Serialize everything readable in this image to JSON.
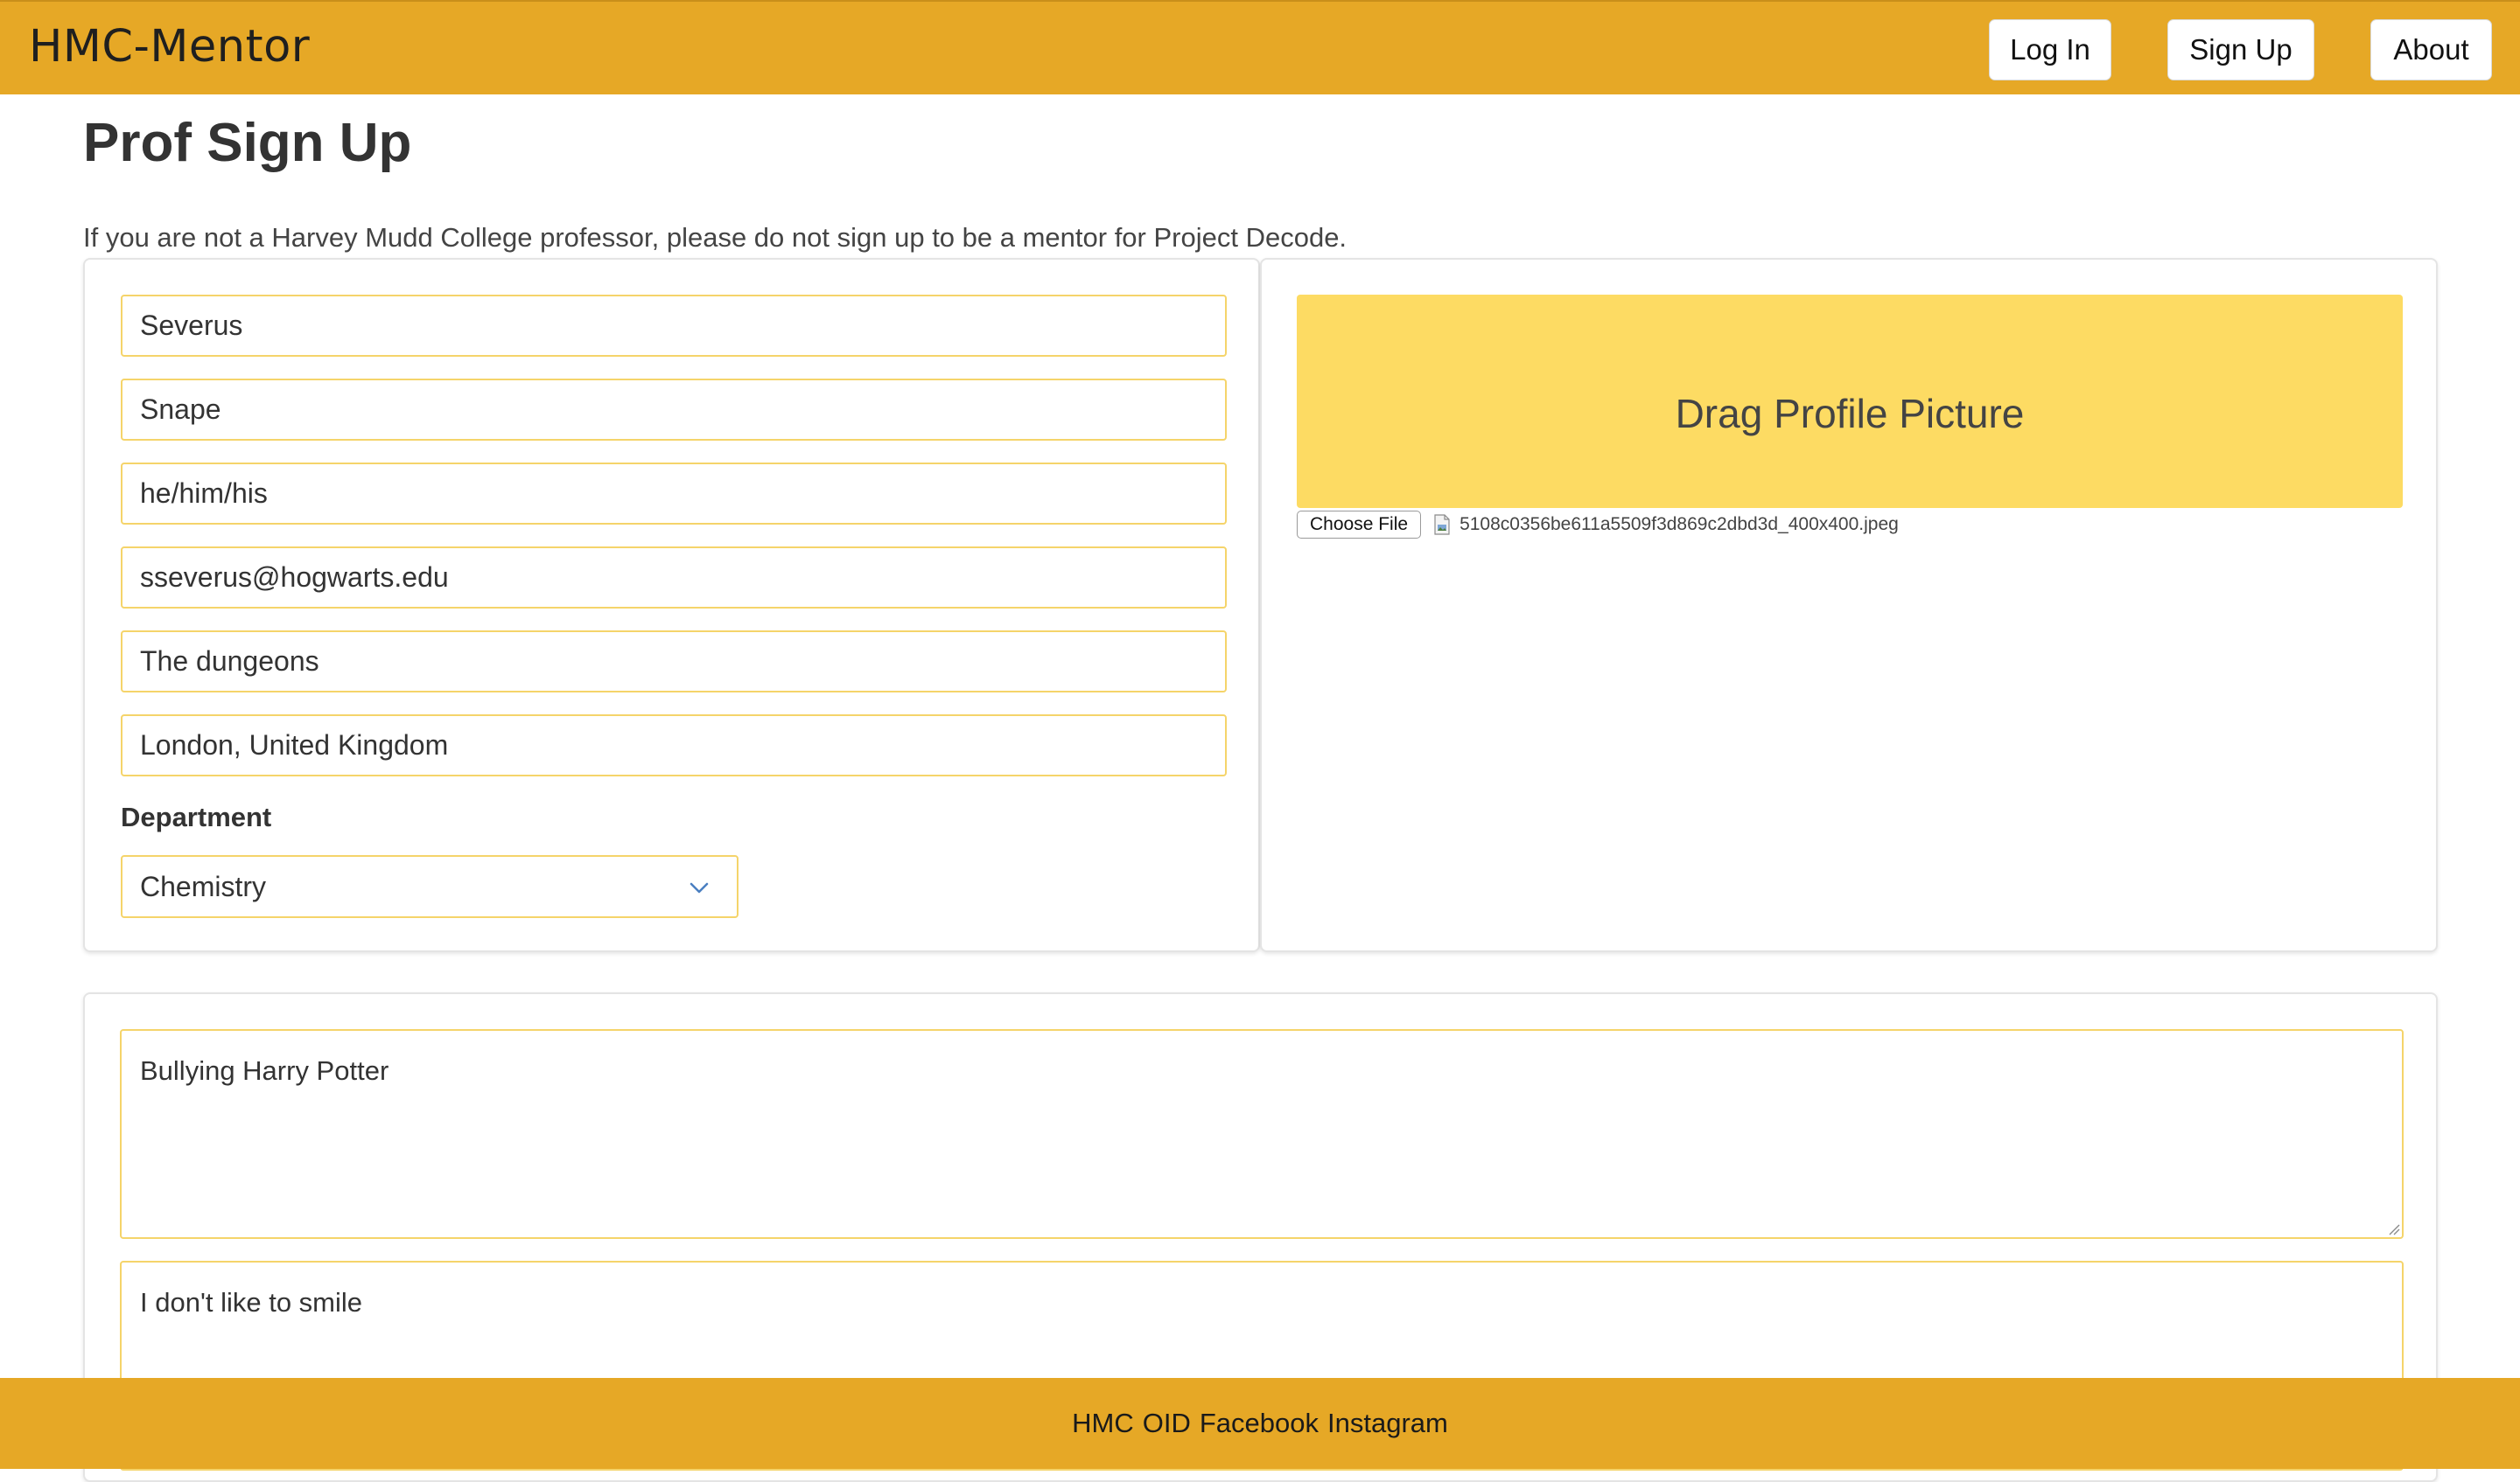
{
  "app": {
    "brand": "HMC-Mentor",
    "accent_color": "#e6a826",
    "field_border_color": "#f5d46a",
    "dropzone_color": "#fddb63"
  },
  "nav": {
    "login": "Log In",
    "signup": "Sign Up",
    "about": "About"
  },
  "page": {
    "title": "Prof Sign Up",
    "notice": "If you are not a Harvey Mudd College professor, please do not sign up to be a mentor for Project Decode."
  },
  "form": {
    "first_name": "Severus",
    "last_name": "Snape",
    "pronouns": "he/him/his",
    "email": "sseverus@hogwarts.edu",
    "office": "The dungeons",
    "location": "London, United Kingdom",
    "department_label": "Department",
    "department_value": "Chemistry",
    "textarea_1": "Bullying Harry Potter",
    "textarea_2": "I don't like to smile"
  },
  "upload": {
    "dropzone_label": "Drag Profile Picture",
    "choose_file": "Choose File",
    "file_name": "5108c0356be611a5509f3d869c2dbd3d_400x400.jpeg",
    "file_icon": "file-image-icon"
  },
  "footer": {
    "links": [
      "HMC",
      "OID",
      "Facebook",
      "Instagram"
    ]
  }
}
